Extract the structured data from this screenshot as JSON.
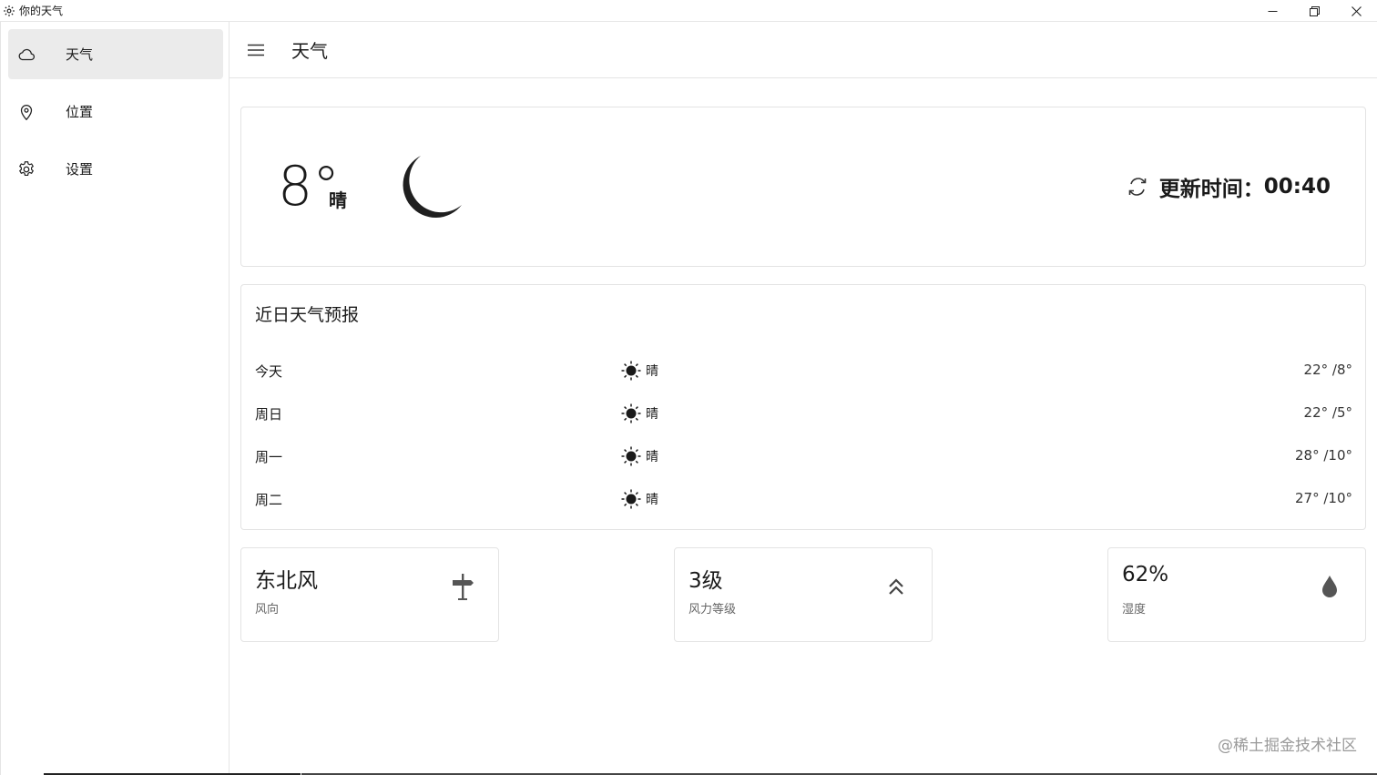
{
  "window": {
    "title": "你的天气",
    "icon": "gear-icon"
  },
  "sidebar": {
    "items": [
      {
        "label": "天气",
        "icon": "cloud-icon",
        "active": true
      },
      {
        "label": "位置",
        "icon": "location-pin-icon",
        "active": false
      },
      {
        "label": "设置",
        "icon": "gear-icon",
        "active": false
      }
    ]
  },
  "header": {
    "title": "天气"
  },
  "current": {
    "temperature": "8°",
    "condition": "晴",
    "icon": "moon-icon",
    "update_label": "更新时间：",
    "update_time": "00:40"
  },
  "forecast": {
    "title": "近日天气预报",
    "rows": [
      {
        "day": "今天",
        "condition": "晴",
        "temps": "22° /8°"
      },
      {
        "day": "周日",
        "condition": "晴",
        "temps": "22° /5°"
      },
      {
        "day": "周一",
        "condition": "晴",
        "temps": "28° /10°"
      },
      {
        "day": "周二",
        "condition": "晴",
        "temps": "27° /10°"
      }
    ]
  },
  "stats": [
    {
      "value": "东北风",
      "label": "风向",
      "icon": "signpost-icon"
    },
    {
      "value": "3级",
      "label": "风力等级",
      "icon": "double-chevron-up-icon"
    },
    {
      "value": "62%",
      "label": "湿度",
      "icon": "water-drop-icon"
    }
  ],
  "watermark": "@稀土掘金技术社区"
}
